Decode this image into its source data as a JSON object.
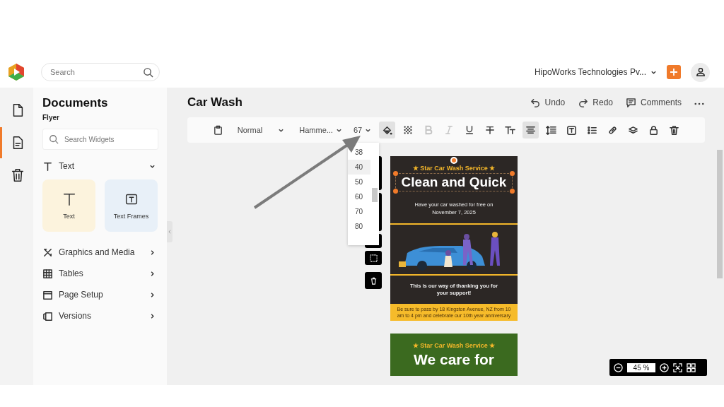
{
  "header": {
    "search": {
      "placeholder": "Search"
    },
    "organization": "HipoWorks Technologies Pv..."
  },
  "rail": [
    {
      "kind": "file",
      "selected": false
    },
    {
      "kind": "document",
      "selected": true
    },
    {
      "kind": "trash",
      "selected": false
    }
  ],
  "panel": {
    "title": "Documents",
    "subtitle": "Flyer",
    "search": {
      "placeholder": "Search Widgets"
    },
    "sections": [
      {
        "label": "Text",
        "kind": "text",
        "expanded": true,
        "widgets": [
          {
            "label": "Text",
            "kind": "text"
          },
          {
            "label": "Text Frames",
            "kind": "frames"
          }
        ]
      },
      {
        "label": "Graphics and Media",
        "kind": "graphics",
        "expanded": false
      },
      {
        "label": "Tables",
        "kind": "table",
        "expanded": false
      },
      {
        "label": "Page Setup",
        "kind": "page",
        "expanded": false
      },
      {
        "label": "Versions",
        "kind": "versions",
        "expanded": false
      }
    ]
  },
  "document": {
    "title": "Car Wash",
    "actions": [
      {
        "label": "Undo",
        "kind": "undo"
      },
      {
        "label": "Redo",
        "kind": "redo"
      },
      {
        "label": "Comments",
        "kind": "comments"
      }
    ]
  },
  "toolbar": {
    "style": "Normal",
    "font": "Hamme...",
    "size": "67",
    "tools": [
      {
        "kind": "fill",
        "selected": true,
        "disabled": false
      },
      {
        "kind": "pattern",
        "selected": false,
        "disabled": false
      },
      {
        "kind": "bold",
        "selected": false,
        "disabled": true
      },
      {
        "kind": "italic",
        "selected": false,
        "disabled": true
      },
      {
        "kind": "underline",
        "selected": false,
        "disabled": false
      },
      {
        "kind": "strike",
        "selected": false,
        "disabled": false
      },
      {
        "kind": "case",
        "selected": false,
        "disabled": false
      },
      {
        "kind": "align",
        "selected": true,
        "disabled": false
      },
      {
        "kind": "spacing",
        "selected": false,
        "disabled": false
      },
      {
        "kind": "textbox",
        "selected": false,
        "disabled": false
      },
      {
        "kind": "list",
        "selected": false,
        "disabled": false
      },
      {
        "kind": "link",
        "selected": false,
        "disabled": false
      },
      {
        "kind": "layers",
        "selected": false,
        "disabled": false
      },
      {
        "kind": "lock",
        "selected": false,
        "disabled": false
      },
      {
        "kind": "delete",
        "selected": false,
        "disabled": false
      }
    ]
  },
  "size_menu": {
    "options": [
      {
        "label": "38",
        "selected": false
      },
      {
        "label": "40",
        "selected": true
      },
      {
        "label": "50",
        "selected": false
      },
      {
        "label": "60",
        "selected": false
      },
      {
        "label": "70",
        "selected": false
      },
      {
        "label": "80",
        "selected": false
      }
    ]
  },
  "pages": [
    {
      "color": "#2c2725",
      "tagline": "★ Star Car Wash Service ★",
      "headline": "Clean and Quick",
      "intro": "Have your car washed for free on November 7, 2025",
      "thanks": "This is our way of thanking you for your support!",
      "footer": "Be sure to pass by 18 Kingston Avenue, NZ from 10 am to 4 pm and celebrate our 10th year anniversary"
    },
    {
      "color": "#3b6a1f",
      "tagline": "★ Star Car Wash Service ★",
      "headline": "We care for"
    }
  ],
  "zoom": {
    "value": "45",
    "unit": "%"
  }
}
